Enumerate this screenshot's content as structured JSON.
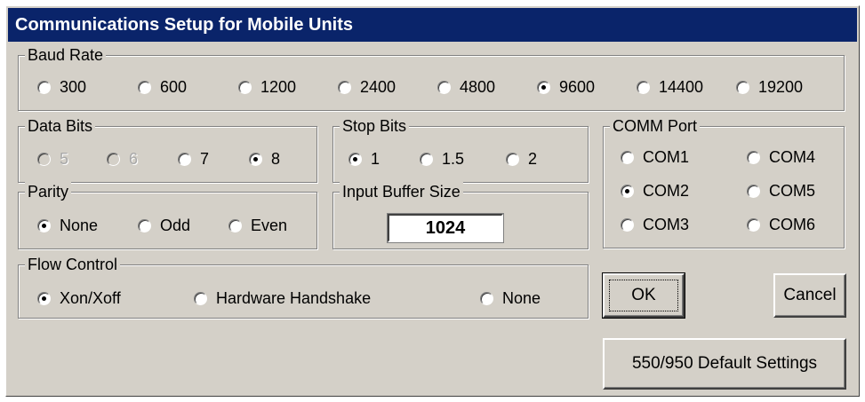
{
  "title": "Communications Setup for Mobile Units",
  "baud_rate": {
    "legend": "Baud Rate",
    "options": [
      "300",
      "600",
      "1200",
      "2400",
      "4800",
      "9600",
      "14400",
      "19200"
    ],
    "selected": "9600"
  },
  "data_bits": {
    "legend": "Data Bits",
    "options": [
      "5",
      "6",
      "7",
      "8"
    ],
    "disabled": [
      "5",
      "6"
    ],
    "selected": "8"
  },
  "stop_bits": {
    "legend": "Stop Bits",
    "options": [
      "1",
      "1.5",
      "2"
    ],
    "selected": "1"
  },
  "comm_port": {
    "legend": "COMM Port",
    "options": [
      "COM1",
      "COM2",
      "COM3",
      "COM4",
      "COM5",
      "COM6"
    ],
    "selected": "COM2"
  },
  "parity": {
    "legend": "Parity",
    "options": [
      "None",
      "Odd",
      "Even"
    ],
    "selected": "None"
  },
  "input_buffer": {
    "legend": "Input Buffer Size",
    "value": "1024"
  },
  "flow_control": {
    "legend": "Flow Control",
    "options": [
      "Xon/Xoff",
      "Hardware Handshake",
      "None"
    ],
    "selected": "Xon/Xoff"
  },
  "buttons": {
    "ok": "OK",
    "cancel": "Cancel",
    "defaults": "550/950 Default Settings"
  }
}
